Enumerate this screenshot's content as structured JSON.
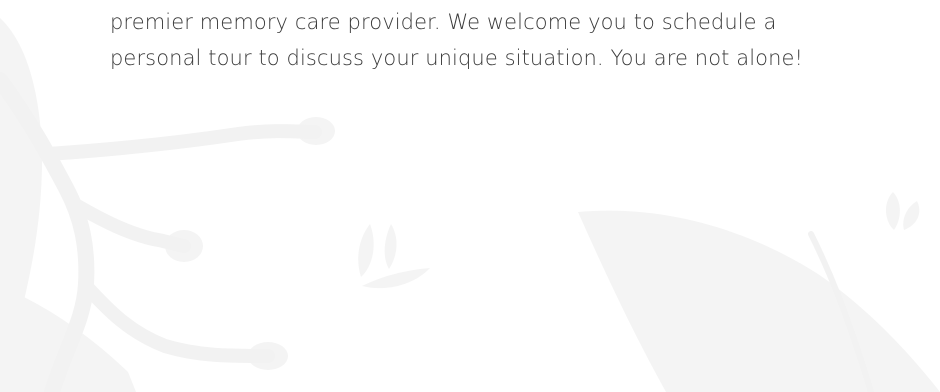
{
  "intro": {
    "line1": "premier memory care provider. We welcome you to schedule a",
    "line2": "personal tour to discuss your unique situation. You are not alone!"
  },
  "colors": {
    "background": "#ffffff",
    "text": "#3a3a3a",
    "decor": "#f3f3f3"
  }
}
